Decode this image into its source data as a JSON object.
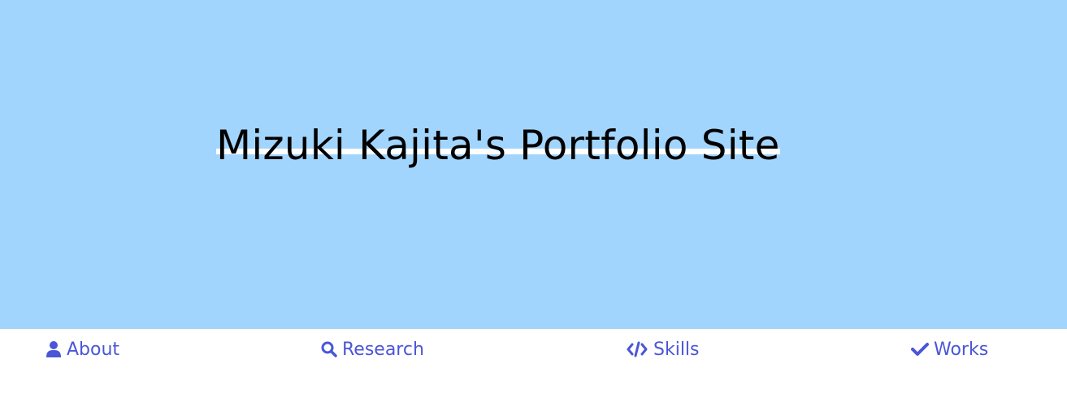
{
  "hero": {
    "title": "Mizuki Kajita's Portfolio Site",
    "background_color": "#a2d5fd",
    "underline_color": "#ffffff"
  },
  "nav": {
    "accent_color": "#4a56d8",
    "items": [
      {
        "label": "About",
        "icon": "user-icon"
      },
      {
        "label": "Research",
        "icon": "search-icon"
      },
      {
        "label": "Skills",
        "icon": "code-icon"
      },
      {
        "label": "Works",
        "icon": "check-icon"
      }
    ]
  }
}
